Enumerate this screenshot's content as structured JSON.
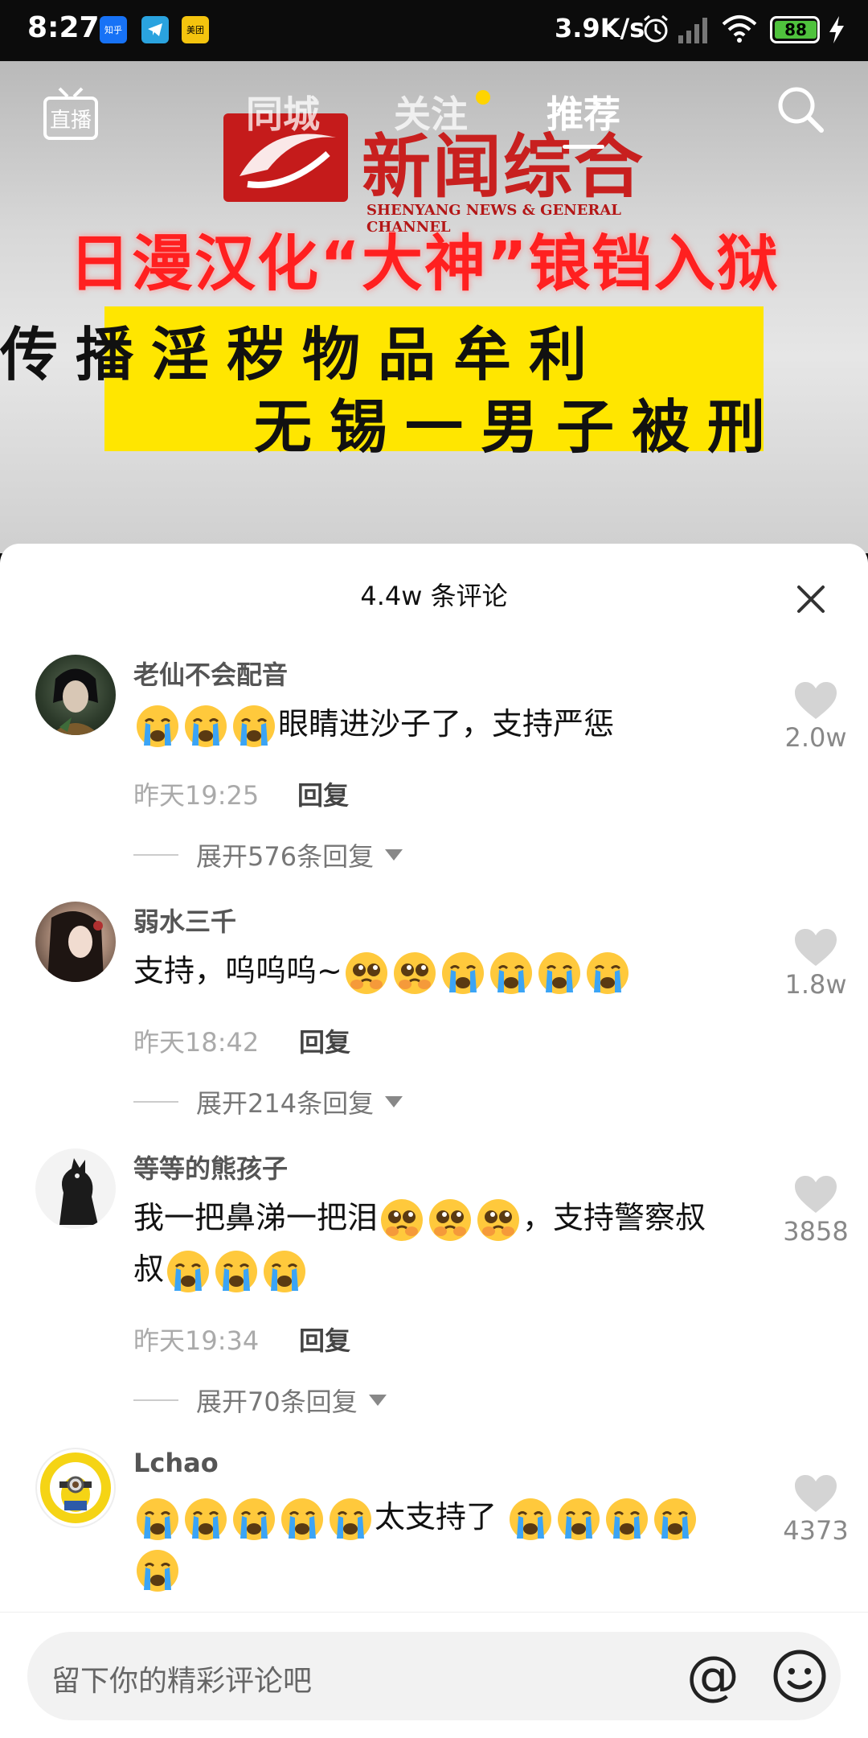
{
  "status_bar": {
    "time": "8:27",
    "apps": [
      "知乎",
      "telegram-icon",
      "美团"
    ],
    "net_speed": "3.9K/s",
    "battery": "88"
  },
  "video": {
    "logo_text": "新闻综合",
    "logo_sub": "SHENYANG NEWS & GENERAL CHANNEL",
    "headline_red": "日漫汉化“大神”锒铛入狱",
    "headline_line1": "传播淫秽物品牟利",
    "headline_line2": "无锡一男子被刑"
  },
  "nav": {
    "live": "直播",
    "tabs": [
      "同城",
      "关注",
      "推荐"
    ],
    "active_tab": "推荐"
  },
  "comments_sheet": {
    "title": "4.4w 条评论",
    "close_icon": "close-icon",
    "comments": [
      {
        "user": "老仙不会配音",
        "emojis_before": 3,
        "text": "眼睛进沙子了，支持严惩",
        "time": "昨天19:25",
        "reply_label": "回复",
        "expand": "展开576条回复",
        "likes": "2.0w"
      },
      {
        "user": "弱水三千",
        "text_before": "支持，呜呜呜~",
        "time": "昨天18:42",
        "reply_label": "回复",
        "expand": "展开214条回复",
        "likes": "1.8w"
      },
      {
        "user": "等等的熊孩子",
        "text_part1": "我一把鼻涕一把泪",
        "text_part2": "，支持警察叔",
        "text_part3": "叔",
        "time": "昨天19:34",
        "reply_label": "回复",
        "expand": "展开70条回复",
        "likes": "3858"
      },
      {
        "user": "Lchao",
        "text": "太支持了",
        "likes": "4373"
      }
    ]
  },
  "input": {
    "placeholder": "留下你的精彩评论吧",
    "at": "@"
  },
  "colors": {
    "sheet_bg": "#ffffff",
    "emoji_face": "#ffc93c",
    "tears": "#3ba4f5",
    "video_title_red": "#ff2020",
    "video_yellow": "#ffe600"
  }
}
